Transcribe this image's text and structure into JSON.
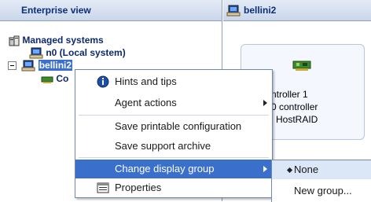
{
  "left_pane": {
    "header": "Enterprise view",
    "tree": {
      "root_label": "Managed systems",
      "local_system": "n0 (Local system)",
      "selected_system": "bellini2",
      "child_partial": "Co"
    }
  },
  "right_pane": {
    "header": "bellini2",
    "card_lines": [
      "ntroller 1",
      "0 controller",
      "l HostRAID"
    ]
  },
  "context_menu": {
    "items": [
      {
        "label": "Hints and tips",
        "icon": "info-icon"
      },
      {
        "label": "Agent actions",
        "submenu": true
      },
      {
        "label": "Save printable configuration"
      },
      {
        "label": "Save support archive"
      },
      {
        "label": "Change display group",
        "submenu": true,
        "highlighted": true
      },
      {
        "label": "Properties",
        "icon": "properties-icon"
      }
    ]
  },
  "submenu": {
    "items": [
      {
        "label": "None",
        "selected": true
      },
      {
        "label": "New group..."
      }
    ]
  },
  "colors": {
    "header_bg": "#c9d6ea",
    "header_text": "#0b2e78",
    "selection": "#3a6fcc",
    "menu_border": "#6f87b5"
  }
}
